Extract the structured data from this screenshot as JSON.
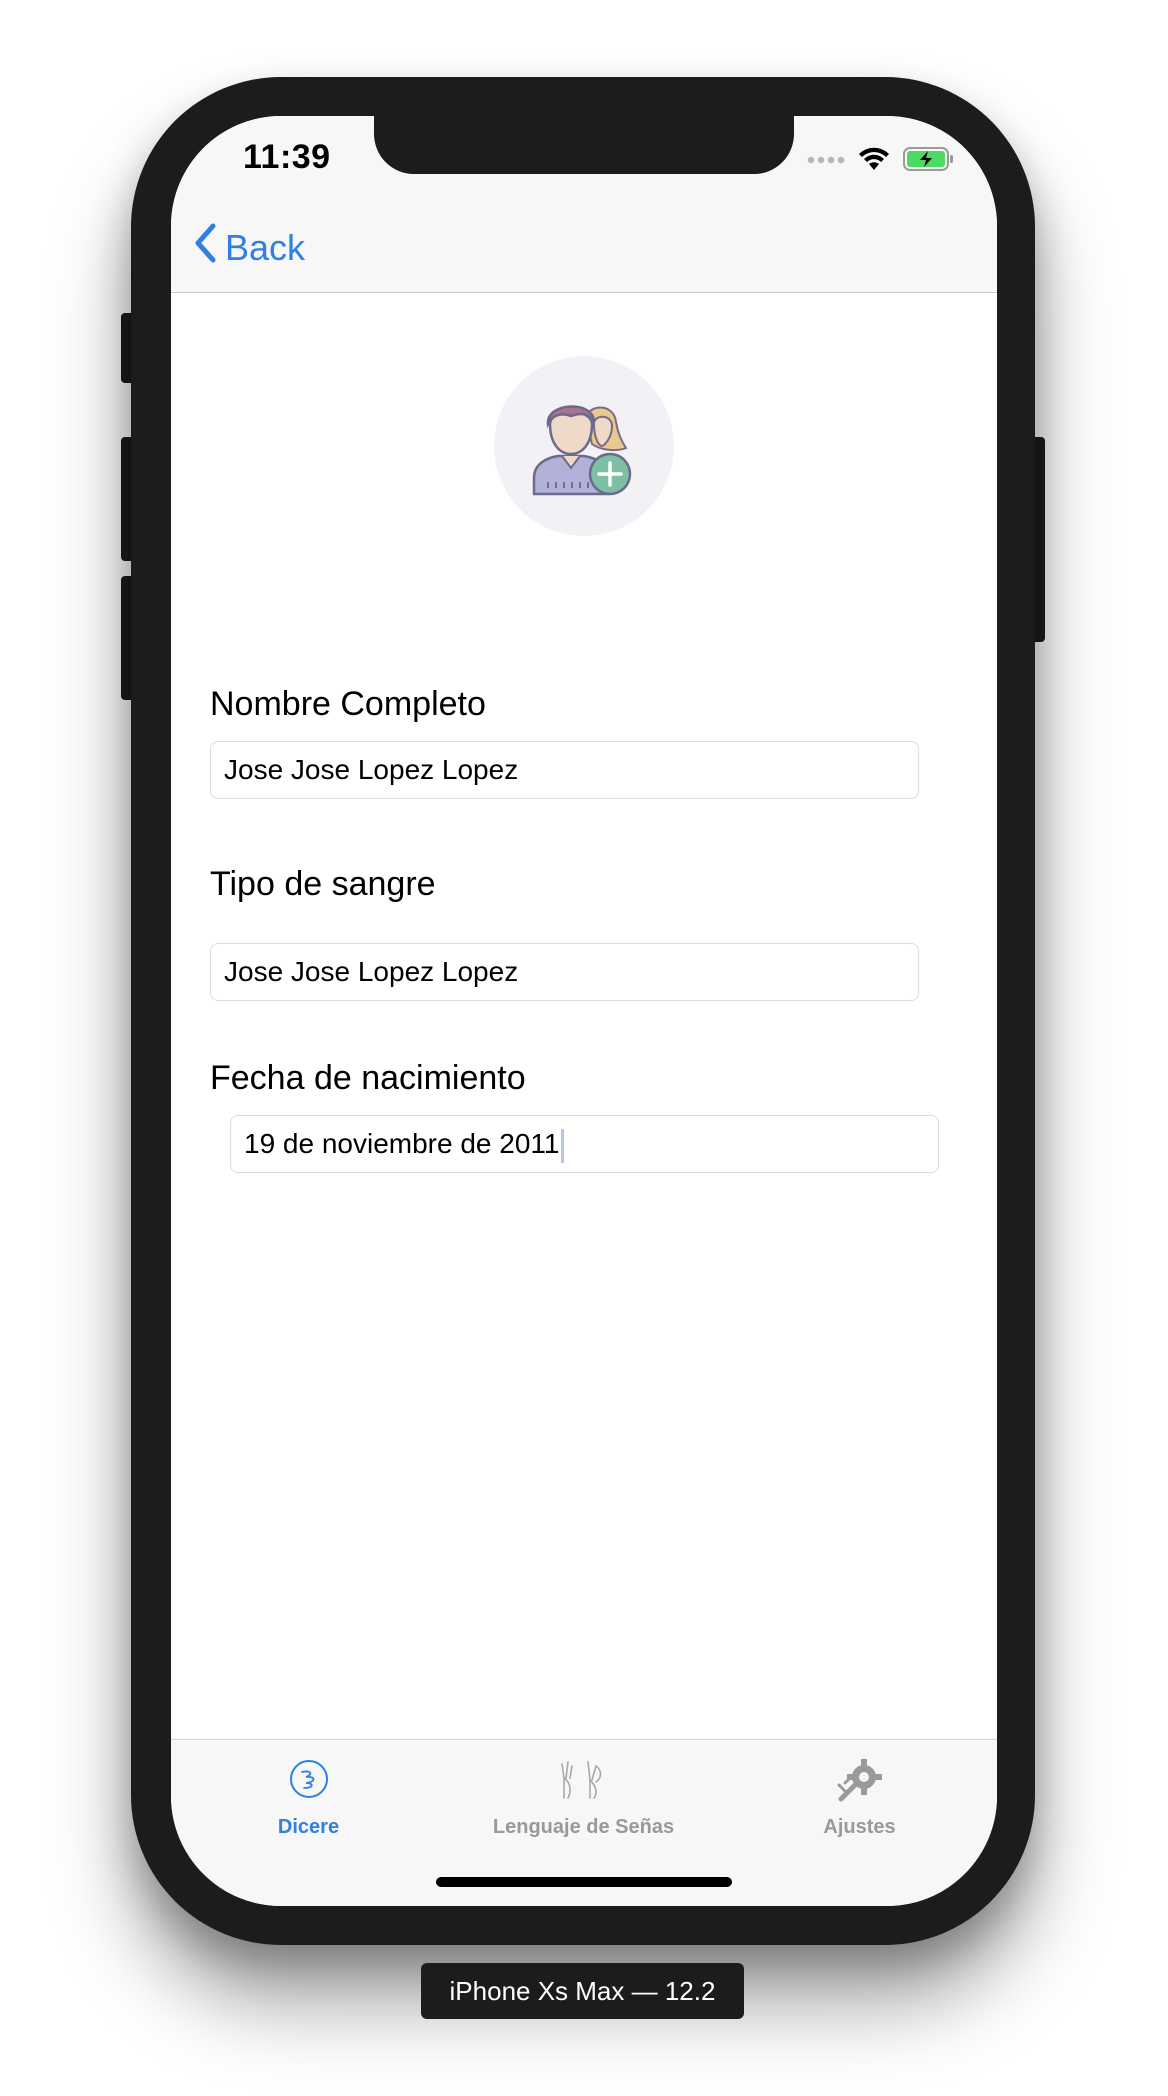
{
  "status_bar": {
    "time": "11:39"
  },
  "nav": {
    "back_label": "Back",
    "accent_color": "#2f7fe4"
  },
  "avatar": {
    "icon": "add-user-icon"
  },
  "form": {
    "full_name": {
      "label": "Nombre Completo",
      "value": "Jose Jose Lopez Lopez"
    },
    "blood_type": {
      "label": "Tipo de sangre",
      "value": "Jose Jose Lopez Lopez"
    },
    "birth_date": {
      "label": "Fecha de nacimiento",
      "value": "19 de noviembre de 2011"
    }
  },
  "tab_bar": {
    "tabs": [
      {
        "label": "Dicere",
        "icon": "dicere-icon",
        "active": true
      },
      {
        "label": "Lenguaje de Señas",
        "icon": "sign-language-icon",
        "active": false
      },
      {
        "label": "Ajustes",
        "icon": "settings-tools-icon",
        "active": false
      }
    ],
    "active_color": "#2f7fe4",
    "inactive_color": "#999999"
  },
  "device_caption": "iPhone Xs Max — 12.2"
}
